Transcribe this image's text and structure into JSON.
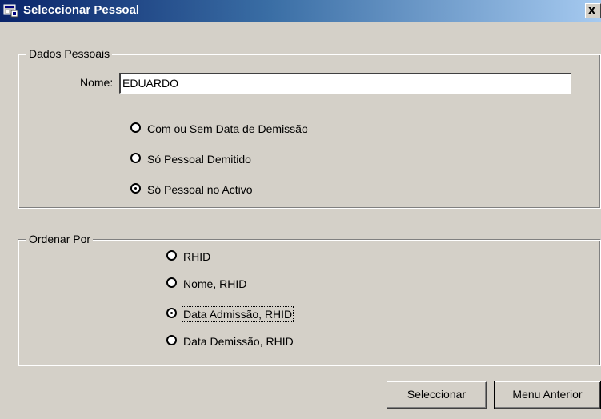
{
  "window": {
    "title": "Seleccionar Pessoal",
    "title_icon": "app-window-icon",
    "close_label": "x"
  },
  "dados_pessoais": {
    "legend": "Dados Pessoais",
    "nome_label": "Nome:",
    "nome_value": "EDUARDO",
    "options": [
      {
        "label": "Com ou Sem Data de Demissão",
        "selected": false
      },
      {
        "label": "Só Pessoal Demitido",
        "selected": false
      },
      {
        "label": "Só Pessoal no Activo",
        "selected": true
      }
    ]
  },
  "ordenar_por": {
    "legend": "Ordenar Por",
    "options": [
      {
        "label": "RHID",
        "selected": false
      },
      {
        "label": "Nome, RHID",
        "selected": false
      },
      {
        "label": "Data Admissão, RHID",
        "selected": true,
        "focused": true
      },
      {
        "label": "Data Demissão, RHID",
        "selected": false
      }
    ]
  },
  "buttons": {
    "seleccionar": "Seleccionar",
    "menu_anterior": "Menu Anterior"
  },
  "colors": {
    "title_gradient_start": "#0a246a",
    "title_gradient_end": "#a6caf0",
    "window_background": "#d4d0c8"
  }
}
